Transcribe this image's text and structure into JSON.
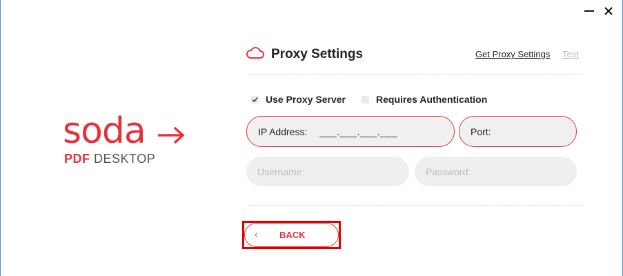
{
  "window": {
    "minimize_icon": "minimize-icon",
    "close_icon": "close-icon"
  },
  "logo": {
    "wordmark": "soda",
    "sub_bold": "PDF",
    "sub_regular": " DESKTOP"
  },
  "header": {
    "icon": "cloud-icon",
    "title": "Proxy Settings",
    "get_proxy_link": "Get Proxy Settings",
    "test_link": "Test"
  },
  "options": {
    "use_proxy": {
      "label": "Use Proxy Server",
      "checked": true
    },
    "requires_auth": {
      "label": "Requires Authentication",
      "checked": false
    }
  },
  "fields": {
    "ip_label": "IP Address:",
    "ip_mask": "___.___.___.___",
    "port_label": "Port:",
    "username_placeholder": "Username:",
    "password_placeholder": "Password:"
  },
  "footer": {
    "back_label": "BACK",
    "back_chevron": "‹"
  },
  "colors": {
    "accent": "#e5323a",
    "highlight": "#e00000",
    "field_bg": "#efefef",
    "muted_text": "#bbbbbb"
  }
}
